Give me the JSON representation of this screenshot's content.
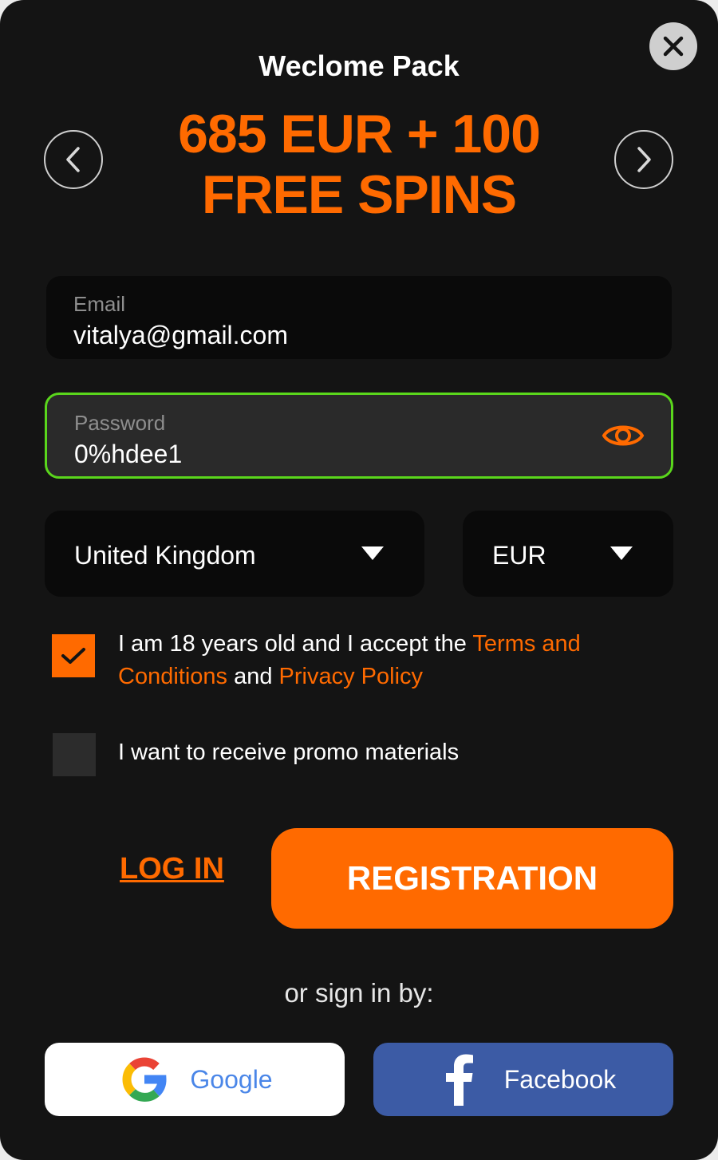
{
  "header": {
    "title": "Weclome Pack",
    "headline_line1": "685 EUR + 100",
    "headline_line2": "FREE SPINS"
  },
  "form": {
    "email": {
      "label": "Email",
      "value": "vitalya@gmail.com"
    },
    "password": {
      "label": "Password",
      "value": "0%hdee1"
    },
    "country": {
      "selected": "United Kingdom"
    },
    "currency": {
      "selected": "EUR"
    },
    "terms": {
      "checked": true,
      "text_before": "I am 18 years old and I accept the ",
      "terms_link": "Terms and Conditions",
      "text_middle": " and ",
      "privacy_link": "Privacy Policy"
    },
    "promo": {
      "checked": false,
      "text": "I want to receive promo materials"
    }
  },
  "actions": {
    "login_label": "LOG IN",
    "register_label": "REGISTRATION",
    "or_text": "or sign in by:",
    "google_label": "Google",
    "facebook_label": "Facebook"
  },
  "icons": {
    "close": "close-icon",
    "prev": "chevron-left-icon",
    "next": "chevron-right-icon",
    "eye": "eye-icon",
    "caret": "caret-down-icon",
    "check": "checkmark-icon",
    "google": "google-logo-icon",
    "facebook": "facebook-logo-icon"
  },
  "colors": {
    "accent": "#ff6a00",
    "valid_border": "#5ad61c",
    "facebook": "#3c5ba5",
    "google_text": "#4a86e8"
  }
}
